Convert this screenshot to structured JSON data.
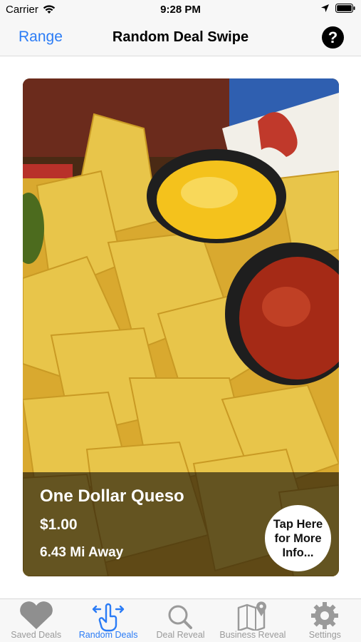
{
  "status_bar": {
    "carrier": "Carrier",
    "time": "9:28 PM"
  },
  "nav": {
    "left_label": "Range",
    "title": "Random Deal Swipe",
    "help_label": "?"
  },
  "deal": {
    "title": "One Dollar Queso",
    "price": "$1.00",
    "distance": "6.43 Mi Away",
    "info_button": "Tap Here for More Info..."
  },
  "tabs": [
    {
      "label": "Saved Deals",
      "icon": "heart-icon"
    },
    {
      "label": "Random Deals",
      "icon": "swipe-hand-icon",
      "active": true
    },
    {
      "label": "Deal Reveal",
      "icon": "magnifier-icon"
    },
    {
      "label": "Business Reveal",
      "icon": "map-pin-icon"
    },
    {
      "label": "Settings",
      "icon": "gear-icon"
    }
  ],
  "colors": {
    "accent": "#2b7cf6",
    "inactive": "#9a9a9a",
    "cheese": "#f4c21c",
    "salsa": "#a52a16",
    "chip": "#e6bf45"
  }
}
